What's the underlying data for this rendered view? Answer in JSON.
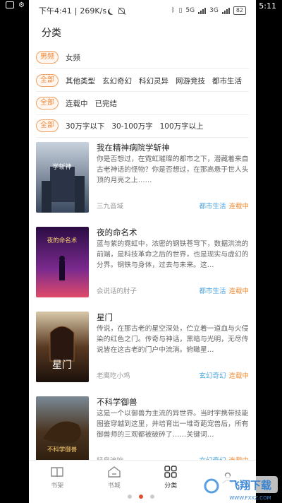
{
  "outer_status": {
    "time": "5:11",
    "left_icons": [
      "message-icon",
      "app-icon"
    ]
  },
  "status": {
    "time": "下午4:41",
    "speed": "269K/s",
    "battery": "82",
    "network": [
      "5G",
      "3G"
    ]
  },
  "page": {
    "title": "分类"
  },
  "filters": [
    {
      "pill": "男频",
      "options": [
        "女频"
      ]
    },
    {
      "pill": "全部",
      "options": [
        "其他类型",
        "玄幻奇幻",
        "科幻灵异",
        "网游竞技",
        "都市生活"
      ]
    },
    {
      "pill": "全部",
      "options": [
        "连载中",
        "已完结"
      ]
    },
    {
      "pill": "全部",
      "options": [
        "30万字以下",
        "30-100万字",
        "100万字以上"
      ]
    }
  ],
  "books": [
    {
      "title": "我在精神病院学斩神",
      "desc": "你是否想过，在霓虹璀璨的都市之下，潜藏着来自古老神话的怪物？你是否想过，在那高悬于世人头顶的月亮之上……",
      "author": "三九音域",
      "tag": "都市生活",
      "status": "连载中",
      "cover_text": "学斩神",
      "cover_color": "#5a6e88"
    },
    {
      "title": "夜的命名术",
      "desc": "蓝与紫的霓虹中，浓密的钢铁苍穹下，数据洪流的前端，是科技革命之后的世界，也是现实与虚幻的分界。钢铁与身体，过去与未来。这…",
      "author": "会说话的肘子",
      "tag": "都市生活",
      "status": "连载中",
      "cover_text": "夜的命名术",
      "cover_color": "#6a2a7e"
    },
    {
      "title": "星门",
      "desc": "传说，在那古老的星空深处，伫立着一道血与火侵染的红色之门。传奇与神话，黑暗与光明，无尽传说皆在这古老的门户中流淌。俯瞰星…",
      "author": "老鹰吃小鸡",
      "tag": "玄幻奇幻",
      "status": "连载中",
      "cover_text": "星门",
      "cover_color": "#3a2418"
    },
    {
      "title": "不科学御兽",
      "desc": "这是一个以御兽为主流的异世界。当时宇携带技能图鉴穿越到这里，并培育出一堆奇葩宠兽后，所有御兽师的三观都被破碎了……关键词…",
      "author": "轻泉流响",
      "tag": "玄幻奇幻",
      "status": "连载中",
      "cover_text": "不科学御兽",
      "cover_color": "#5a4020"
    }
  ],
  "tabs": [
    {
      "label": "书架",
      "icon": "book-icon"
    },
    {
      "label": "书城",
      "icon": "store-icon"
    },
    {
      "label": "分类",
      "icon": "grid-icon"
    }
  ],
  "watermark": {
    "text": "飞翔下载",
    "sub": "WWW.FXXZ.COM"
  }
}
